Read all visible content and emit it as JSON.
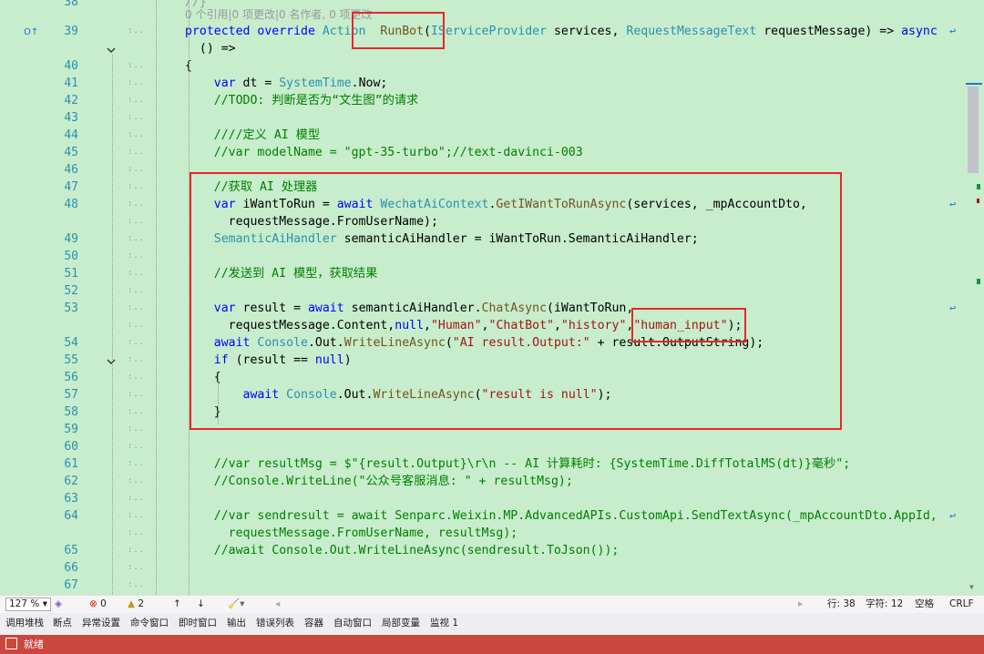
{
  "editor": {
    "codelens": "0 个引用|0 项更改|0 名作者, 0 项更改",
    "top_partial": "38",
    "lines": [
      {
        "n": "39",
        "segs": [
          [
            "kw",
            "protected override "
          ],
          [
            "ty",
            "Action"
          ],
          [
            "",
            "  "
          ],
          [
            "mt",
            "RunBot"
          ],
          [
            "",
            "("
          ],
          [
            "ty",
            "IServiceProvider"
          ],
          [
            "",
            " services, "
          ],
          [
            "ty",
            "RequestMessageText"
          ],
          [
            "",
            " requestMessage) => "
          ],
          [
            "kw",
            "async"
          ]
        ]
      },
      {
        "n": "",
        "segs": [
          [
            "",
            "  () =>"
          ]
        ]
      },
      {
        "n": "40",
        "segs": [
          [
            "",
            "{"
          ]
        ]
      },
      {
        "n": "41",
        "segs": [
          [
            "kw",
            "    var"
          ],
          [
            "",
            " dt = "
          ],
          [
            "ty",
            "SystemTime"
          ],
          [
            "",
            ".Now;"
          ]
        ]
      },
      {
        "n": "42",
        "segs": [
          [
            "cm",
            "    //TODO: 判断是否为“文生图”的请求"
          ]
        ]
      },
      {
        "n": "43",
        "segs": []
      },
      {
        "n": "44",
        "segs": [
          [
            "cm",
            "    ////定义 AI 模型"
          ]
        ]
      },
      {
        "n": "45",
        "segs": [
          [
            "cm",
            "    //var modelName = \"gpt-35-turbo\";//text-davinci-003"
          ]
        ]
      },
      {
        "n": "46",
        "segs": []
      },
      {
        "n": "47",
        "segs": [
          [
            "cm",
            "    //获取 AI 处理器"
          ]
        ]
      },
      {
        "n": "48",
        "segs": [
          [
            "kw",
            "    var"
          ],
          [
            "",
            " iWantToRun = "
          ],
          [
            "kw",
            "await "
          ],
          [
            "ty",
            "WechatAiContext"
          ],
          [
            "",
            "."
          ],
          [
            "mt",
            "GetIWantToRunAsync"
          ],
          [
            "",
            "(services, _mpAccountDto,"
          ]
        ]
      },
      {
        "n": "",
        "segs": [
          [
            "",
            "      requestMessage.FromUserName);"
          ]
        ]
      },
      {
        "n": "49",
        "segs": [
          [
            "ty",
            "    SemanticAiHandler"
          ],
          [
            "",
            " semanticAiHandler = iWantToRun.SemanticAiHandler;"
          ]
        ]
      },
      {
        "n": "50",
        "segs": []
      },
      {
        "n": "51",
        "segs": [
          [
            "cm",
            "    //发送到 AI 模型，获取结果"
          ]
        ]
      },
      {
        "n": "52",
        "segs": []
      },
      {
        "n": "53",
        "segs": [
          [
            "kw",
            "    var"
          ],
          [
            "",
            " result = "
          ],
          [
            "kw",
            "await "
          ],
          [
            "",
            "semanticAiHandler."
          ],
          [
            "mt",
            "ChatAsync"
          ],
          [
            "",
            "(iWantToRun,"
          ]
        ]
      },
      {
        "n": "",
        "segs": [
          [
            "",
            "      requestMessage.Content,"
          ],
          [
            "kw",
            "null"
          ],
          [
            "",
            ","
          ],
          [
            "st",
            "\"Human\""
          ],
          [
            "",
            ","
          ],
          [
            "st",
            "\"ChatBot\""
          ],
          [
            "",
            ","
          ],
          [
            "st",
            "\"history\""
          ],
          [
            "",
            ","
          ],
          [
            "st",
            "\"human_input\""
          ],
          [
            "",
            ");"
          ]
        ]
      },
      {
        "n": "54",
        "segs": [
          [
            "kw",
            "    await "
          ],
          [
            "ty",
            "Console"
          ],
          [
            "",
            ".Out."
          ],
          [
            "mt",
            "WriteLineAsync"
          ],
          [
            "",
            "("
          ],
          [
            "st",
            "\"AI result.Output:\""
          ],
          [
            "",
            " + result.OutputString);"
          ]
        ]
      },
      {
        "n": "55",
        "segs": [
          [
            "kw",
            "    if"
          ],
          [
            "",
            " (result == "
          ],
          [
            "kw",
            "null"
          ],
          [
            "",
            ")"
          ]
        ]
      },
      {
        "n": "56",
        "segs": [
          [
            "",
            "    {"
          ]
        ]
      },
      {
        "n": "57",
        "segs": [
          [
            "kw",
            "        await "
          ],
          [
            "ty",
            "Console"
          ],
          [
            "",
            ".Out."
          ],
          [
            "mt",
            "WriteLineAsync"
          ],
          [
            "",
            "("
          ],
          [
            "st",
            "\"result is null\""
          ],
          [
            "",
            ");"
          ]
        ]
      },
      {
        "n": "58",
        "segs": [
          [
            "",
            "    }"
          ]
        ]
      },
      {
        "n": "59",
        "segs": []
      },
      {
        "n": "60",
        "segs": []
      },
      {
        "n": "61",
        "segs": [
          [
            "cm",
            "    //var resultMsg = $\"{result.Output}\\r\\n -- AI 计算耗时: {SystemTime.DiffTotalMS(dt)}毫秒\";"
          ]
        ]
      },
      {
        "n": "62",
        "segs": [
          [
            "cm",
            "    //Console.WriteLine(\"公众号客服消息: \" + resultMsg);"
          ]
        ]
      },
      {
        "n": "63",
        "segs": []
      },
      {
        "n": "64",
        "segs": [
          [
            "cm",
            "    //var sendresult = await Senparc.Weixin.MP.AdvancedAPIs.CustomApi.SendTextAsync(_mpAccountDto.AppId,"
          ]
        ]
      },
      {
        "n": "",
        "segs": [
          [
            "cm",
            "      requestMessage.FromUserName, resultMsg);"
          ]
        ]
      },
      {
        "n": "65",
        "segs": [
          [
            "cm",
            "    //await Console.Out.WriteLineAsync(sendresult.ToJson());"
          ]
        ]
      },
      {
        "n": "66",
        "segs": []
      },
      {
        "n": "67",
        "segs": []
      }
    ]
  },
  "status": {
    "zoom": "127 %",
    "errors": "0",
    "warnings": "2",
    "position_line": "行: 38",
    "position_char": "字符: 12",
    "whitespace": "空格",
    "line_ending": "CRLF"
  },
  "tool_windows": [
    "调用堆栈",
    "断点",
    "异常设置",
    "命令窗口",
    "即时窗口",
    "输出",
    "错误列表",
    "容器",
    "自动窗口",
    "局部变量",
    "监视 1"
  ],
  "ready": "就绪",
  "colors": {
    "editor_bg": "#c7edcc",
    "highlight_box": "#e8262a",
    "status_bar": "#c9473c"
  }
}
